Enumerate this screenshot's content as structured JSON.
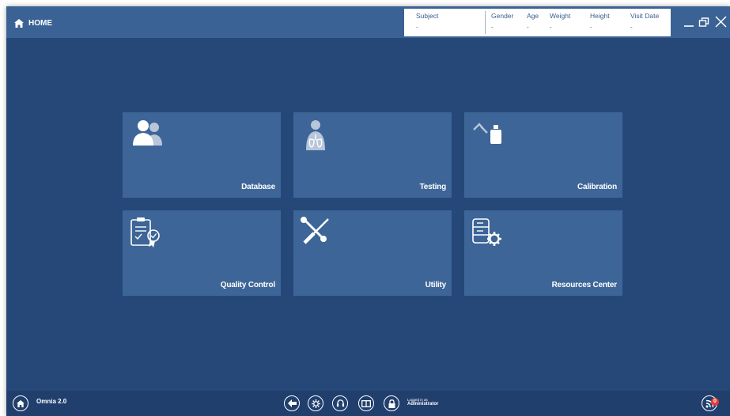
{
  "header": {
    "home_label": "HOME",
    "patient": {
      "subject_label": "Subject",
      "subject_value": "-",
      "gender_label": "Gender",
      "gender_value": "-",
      "age_label": "Age",
      "age_value": "-",
      "weight_label": "Weight",
      "weight_value": "-",
      "height_label": "Height",
      "height_value": "-",
      "visit_date_label": "Visit Date",
      "visit_date_value": "-"
    }
  },
  "tiles": [
    {
      "label": "Database",
      "icon": "users-icon"
    },
    {
      "label": "Testing",
      "icon": "patient-lungs-icon"
    },
    {
      "label": "Calibration",
      "icon": "calibration-syringe-icon"
    },
    {
      "label": "Quality Control",
      "icon": "clipboard-check-icon"
    },
    {
      "label": "Utility",
      "icon": "wrench-screwdriver-icon"
    },
    {
      "label": "Resources Center",
      "icon": "server-gear-icon"
    }
  ],
  "footer": {
    "brand": "Omnia 2.0",
    "logged_in_label": "Logged in as",
    "user": "Administrator",
    "notification_count": "0"
  },
  "colors": {
    "background": "#264879",
    "tile": "#3d6597",
    "titlebar": "#3b6294",
    "bottombar": "#213f6d",
    "badge": "#e53935"
  }
}
